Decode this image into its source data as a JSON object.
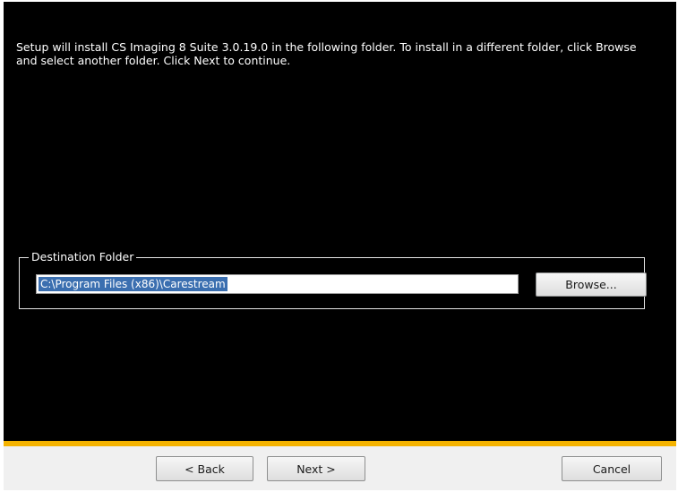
{
  "instructions": "Setup will install CS Imaging 8 Suite 3.0.19.0 in the following folder. To install in a different folder, click Browse and select another folder. Click Next to continue.",
  "destination": {
    "legend": "Destination Folder",
    "path": "C:\\Program Files (x86)\\Carestream",
    "browse_label": "Browse..."
  },
  "buttons": {
    "back_label": "< Back",
    "next_label": "Next >",
    "cancel_label": "Cancel"
  },
  "colors": {
    "background": "#000000",
    "accent": "#f5b300",
    "selection": "#3b6fb0"
  }
}
